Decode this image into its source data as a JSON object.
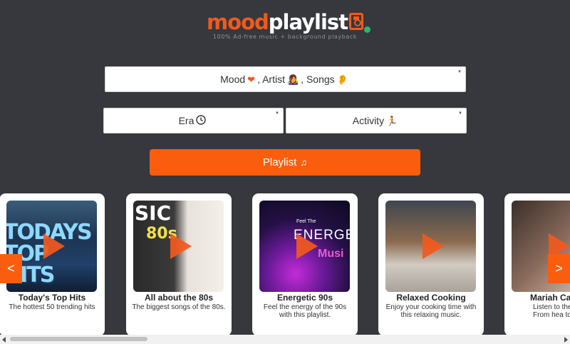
{
  "brand": {
    "name_part1": "mood",
    "name_part2": "playlist",
    "tagline": "100% Ad-free music + background playback"
  },
  "colors": {
    "accent": "#fb5d0f",
    "background": "#36383d",
    "status_dot": "#2bb673"
  },
  "filters": {
    "mood_artist_songs": {
      "mood_label": "Mood",
      "artist_label": ", Artist",
      "songs_label": ", Songs",
      "icons": [
        "heart-icon",
        "singer-icon",
        "ear-icon"
      ]
    },
    "era": {
      "label": "Era",
      "icon": "clock-icon"
    },
    "activity": {
      "label": "Activity",
      "icon": "runner-icon"
    }
  },
  "playlist_button": {
    "label": "Playlist",
    "icon": "music-note-icon"
  },
  "carousel": {
    "prev_label": "<",
    "next_label": ">",
    "cards": [
      {
        "title": "Today's Top Hits",
        "description": "The hottest 50 trending hits",
        "thumb_text": "TODAYS TOP HITS"
      },
      {
        "title": "All about the 80s",
        "description": "The biggest songs of the 80s.",
        "thumb_text": "SIC",
        "thumb_text2": "80s"
      },
      {
        "title": "Energetic 90s",
        "description": "Feel the energy of the 90s with this playlist.",
        "thumb_text_small": "Feel The",
        "thumb_text": "ENERGETI",
        "thumb_text2": "Musi"
      },
      {
        "title": "Relaxed Cooking",
        "description": "Enjoy your cooking time with this relaxing music."
      },
      {
        "title": "Mariah Ca",
        "description": "Listen to the qu vocals. From hea to honey"
      }
    ]
  }
}
